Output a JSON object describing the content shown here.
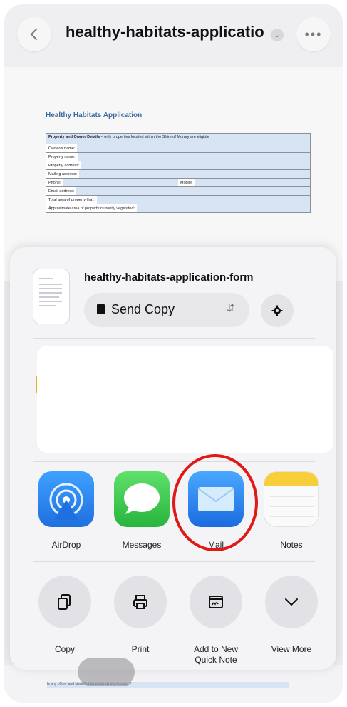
{
  "header": {
    "title": "healthy-habitats-application-form",
    "title_display": "healthy-habitats-applicatio...",
    "back_icon": "chevron-left-icon",
    "more_icon": "ellipsis-icon"
  },
  "document": {
    "heading": "Healthy Habitats Application",
    "section_title": "Property and Owner Details",
    "section_note": "– only properties located within the Shire of Murray are eligible",
    "fields": [
      "Owner/s name:",
      "Property name:",
      "Property address:",
      "Mailing address:",
      "Phone:",
      "Mobile:",
      "Email address:",
      "Total area of property (ha):",
      "Approximate area of property currently vegetated:"
    ],
    "bottom_text": "Is any of the land identified as wetland/river frontage?"
  },
  "share_sheet": {
    "filename": "healthy-habitats-application-form",
    "send_mode": "Send Copy",
    "apps": [
      {
        "label": "AirDrop",
        "icon": "airdrop-icon"
      },
      {
        "label": "Messages",
        "icon": "messages-icon"
      },
      {
        "label": "Mail",
        "icon": "mail-icon"
      },
      {
        "label": "Notes",
        "icon": "notes-icon"
      }
    ],
    "actions": [
      {
        "label": "Copy",
        "icon": "copy-icon"
      },
      {
        "label": "Print",
        "icon": "printer-icon"
      },
      {
        "label": "Add to New Quick Note",
        "icon": "quick-note-icon"
      },
      {
        "label": "View More",
        "icon": "chevron-down-icon"
      }
    ]
  },
  "colors": {
    "highlight": "#e01818",
    "form_fill": "#d6e4f3",
    "heading": "#3b6aa0"
  }
}
